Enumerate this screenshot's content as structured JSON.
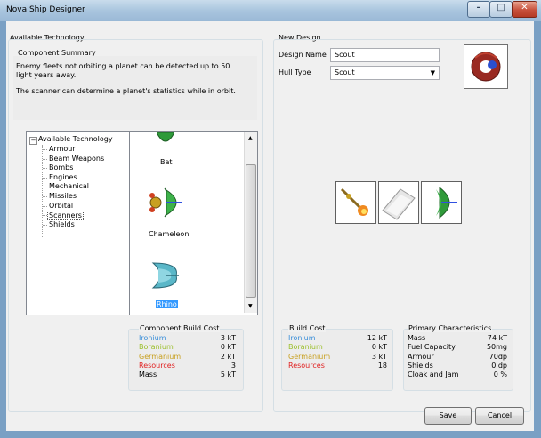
{
  "window": {
    "title": "Nova Ship Designer"
  },
  "available_technology": {
    "group_label": "Available Technology",
    "summary_label": "Component Summary",
    "summary_text_1": "Enemy fleets not orbiting a planet can be detected up to 50 light years away.",
    "summary_text_2": "The scanner can determine a planet's statistics while in orbit.",
    "tree": {
      "root": "Available Technology",
      "items": [
        "Armour",
        "Beam Weapons",
        "Bombs",
        "Engines",
        "Mechanical",
        "Missiles",
        "Orbital",
        "Scanners",
        "Shields"
      ],
      "selected": "Scanners"
    },
    "components": [
      {
        "name": "Bat",
        "icon": "dish-icon"
      },
      {
        "name": "Chameleon",
        "icon": "chameleon-scanner-icon"
      },
      {
        "name": "Rhino",
        "icon": "rhino-scanner-icon",
        "selected": true
      }
    ]
  },
  "component_build_cost": {
    "label": "Component Build Cost",
    "rows": [
      {
        "name": "Ironium",
        "value": "3 kT",
        "color": "#3b8fd9"
      },
      {
        "name": "Boranium",
        "value": "0 kT",
        "color": "#9bbf2a"
      },
      {
        "name": "Germanium",
        "value": "2 kT",
        "color": "#c8a020"
      },
      {
        "name": "Resources",
        "value": "3",
        "color": "#e02020"
      },
      {
        "name": "Mass",
        "value": "5 kT",
        "color": "#000000"
      }
    ]
  },
  "new_design": {
    "group_label": "New Design",
    "design_name_label": "Design Name",
    "design_name_value": "Scout",
    "hull_type_label": "Hull Type",
    "hull_type_value": "Scout",
    "slots": [
      "engine-icon",
      "empty-hull-icon",
      "scanner-dish-icon"
    ]
  },
  "build_cost": {
    "label": "Build Cost",
    "rows": [
      {
        "name": "Ironium",
        "value": "12 kT",
        "color": "#3b8fd9"
      },
      {
        "name": "Boranium",
        "value": "0 kT",
        "color": "#9bbf2a"
      },
      {
        "name": "Germanium",
        "value": "3 kT",
        "color": "#c8a020"
      },
      {
        "name": "Resources",
        "value": "18",
        "color": "#e02020"
      }
    ]
  },
  "primary_characteristics": {
    "label": "Primary Characteristics",
    "rows": [
      {
        "name": "Mass",
        "value": "74 kT"
      },
      {
        "name": "Fuel Capacity",
        "value": "50mg"
      },
      {
        "name": "Armour",
        "value": "70dp"
      },
      {
        "name": "Shields",
        "value": "0 dp"
      },
      {
        "name": "Cloak and Jam",
        "value": "0 %"
      }
    ]
  },
  "buttons": {
    "save": "Save",
    "cancel": "Cancel"
  }
}
